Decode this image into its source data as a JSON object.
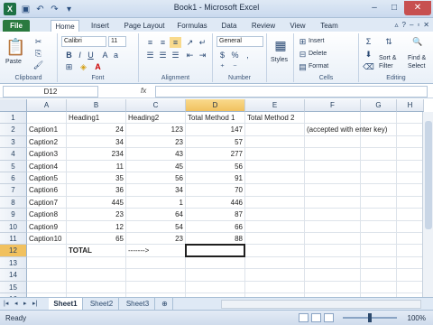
{
  "window": {
    "title": "Book1 - Microsoft Excel"
  },
  "tabs": [
    "File",
    "Home",
    "Insert",
    "Page Layout",
    "Formulas",
    "Data",
    "Review",
    "View",
    "Team"
  ],
  "ribbon": {
    "clipboard": {
      "paste": "Paste",
      "label": "Clipboard"
    },
    "font": {
      "name": "Calibri",
      "size": "11",
      "label": "Font"
    },
    "alignment": {
      "label": "Alignment"
    },
    "number": {
      "format": "General",
      "label": "Number"
    },
    "styles": {
      "label": "Styles"
    },
    "cells": {
      "insert": "Insert",
      "delete": "Delete",
      "format": "Format",
      "label": "Cells"
    },
    "editing": {
      "sort": "Sort &",
      "filter": "Filter",
      "find": "Find &",
      "select": "Select",
      "label": "Editing"
    }
  },
  "formula_bar": {
    "name_box": "D12",
    "fx": "fx",
    "content": ""
  },
  "columns": [
    "A",
    "B",
    "C",
    "D",
    "E",
    "F",
    "G",
    "H"
  ],
  "selected_column": "D",
  "selected_row": "12",
  "rows": [
    "1",
    "2",
    "3",
    "4",
    "5",
    "6",
    "7",
    "8",
    "9",
    "10",
    "11",
    "12",
    "13",
    "14",
    "15",
    "16"
  ],
  "cells": {
    "B1": "Heading1",
    "C1": "Heading2",
    "D1": "Total Method 1",
    "E1": "Total Method 2",
    "A2": "Caption1",
    "B2": "24",
    "C2": "123",
    "D2": "147",
    "F2": "(accepted with enter key)",
    "A3": "Caption2",
    "B3": "34",
    "C3": "23",
    "D3": "57",
    "A4": "Caption3",
    "B4": "234",
    "C4": "43",
    "D4": "277",
    "A5": "Caption4",
    "B5": "11",
    "C5": "45",
    "D5": "56",
    "A6": "Caption5",
    "B6": "35",
    "C6": "56",
    "D6": "91",
    "A7": "Caption6",
    "B7": "36",
    "C7": "34",
    "D7": "70",
    "A8": "Caption7",
    "B8": "445",
    "C8": "1",
    "D8": "446",
    "A9": "Caption8",
    "B9": "23",
    "C9": "64",
    "D9": "87",
    "A10": "Caption9",
    "B10": "12",
    "C10": "54",
    "D10": "66",
    "A11": "Caption10",
    "B11": "65",
    "C11": "23",
    "D11": "88",
    "B12": "TOTAL",
    "C12": "------->"
  },
  "sheets": [
    "Sheet1",
    "Sheet2",
    "Sheet3"
  ],
  "active_sheet": "Sheet1",
  "status": {
    "ready": "Ready",
    "zoom": "100%"
  },
  "colors": {
    "file_tab": "#2a7a3f",
    "selection": "#f1c15f",
    "close": "#c75050"
  }
}
